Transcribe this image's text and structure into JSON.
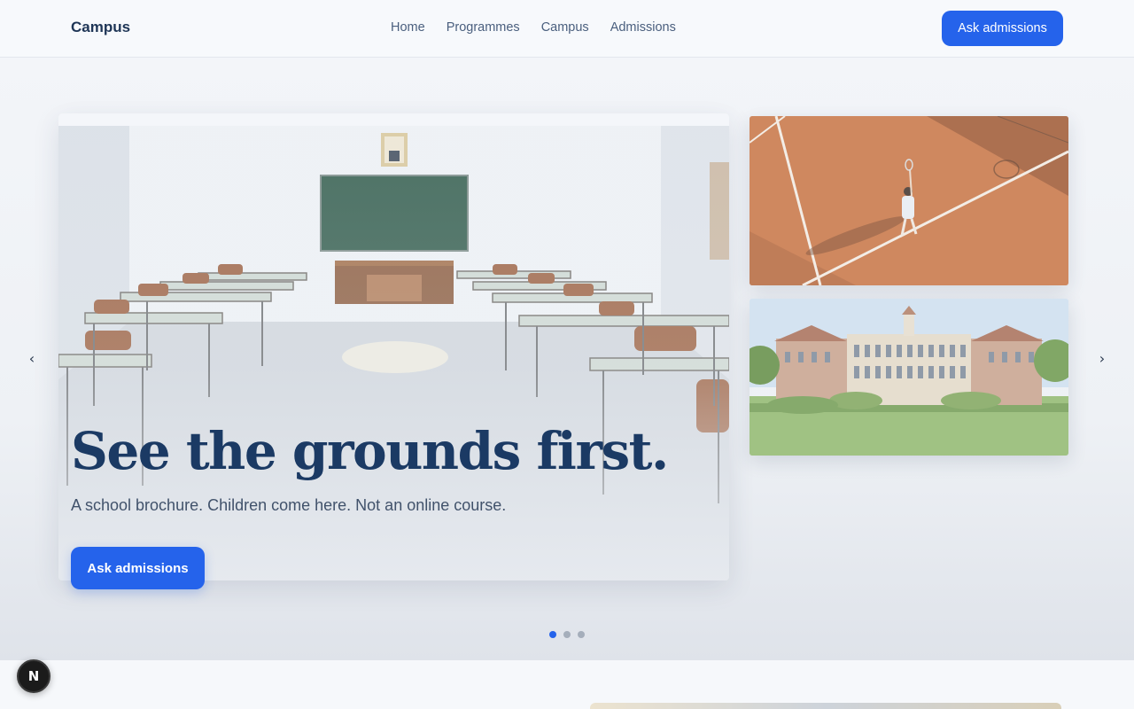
{
  "header": {
    "brand": "Campus",
    "nav": [
      {
        "label": "Home"
      },
      {
        "label": "Programmes"
      },
      {
        "label": "Campus"
      },
      {
        "label": "Admissions"
      }
    ],
    "cta_label": "Ask admissions"
  },
  "hero": {
    "title": "See the grounds first.",
    "subtitle": "A school brochure. Children come here. Not an online course.",
    "cta_label": "Ask admissions",
    "prev_arrow": "‹",
    "next_arrow": "›",
    "slide_count": 3,
    "active_slide": 1
  },
  "dev_badge": {
    "label": "N"
  },
  "colors": {
    "accent": "#2563eb",
    "title": "#1b3a64",
    "text": "#41526b",
    "background": "#f6f8fb"
  }
}
